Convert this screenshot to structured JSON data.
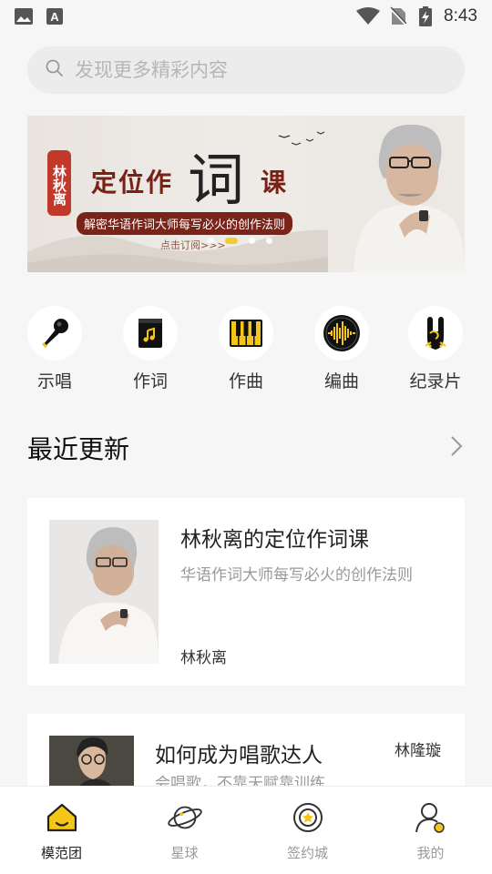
{
  "status_bar": {
    "time": "8:43",
    "icons": [
      "image-icon",
      "a-icon",
      "wifi-icon",
      "sim-off-icon",
      "battery-charging-icon"
    ]
  },
  "search": {
    "placeholder": "发现更多精彩内容"
  },
  "banner": {
    "seal_text": "林秋离",
    "title_left": "定位作",
    "title_big": "词",
    "title_right": "课",
    "subtitle": "解密华语作词大师每写必火的创作法则",
    "cta": "点击订阅>>>",
    "dots_count": 4,
    "active_dot": 1,
    "accent_color": "#7a2318"
  },
  "categories": [
    {
      "label": "示唱",
      "icon": "microphone-icon"
    },
    {
      "label": "作词",
      "icon": "notebook-music-icon"
    },
    {
      "label": "作曲",
      "icon": "piano-keys-icon"
    },
    {
      "label": "编曲",
      "icon": "waveform-icon"
    },
    {
      "label": "纪录片",
      "icon": "rock-hand-icon"
    }
  ],
  "recent": {
    "title": "最近更新",
    "items": [
      {
        "title": "林秋离的定位作词课",
        "subtitle": "华语作词大师每写必火的创作法则",
        "author": "林秋离"
      },
      {
        "title": "如何成为唱歌达人",
        "subtitle": "会唱歌，不靠天赋靠训练",
        "author": "林隆璇"
      }
    ]
  },
  "tabbar": {
    "active_color": "#f5c518",
    "tabs": [
      {
        "label": "模范团",
        "icon": "home-icon",
        "active": true
      },
      {
        "label": "星球",
        "icon": "planet-icon",
        "active": false
      },
      {
        "label": "签约城",
        "icon": "medal-icon",
        "active": false
      },
      {
        "label": "我的",
        "icon": "profile-icon",
        "active": false
      }
    ]
  }
}
